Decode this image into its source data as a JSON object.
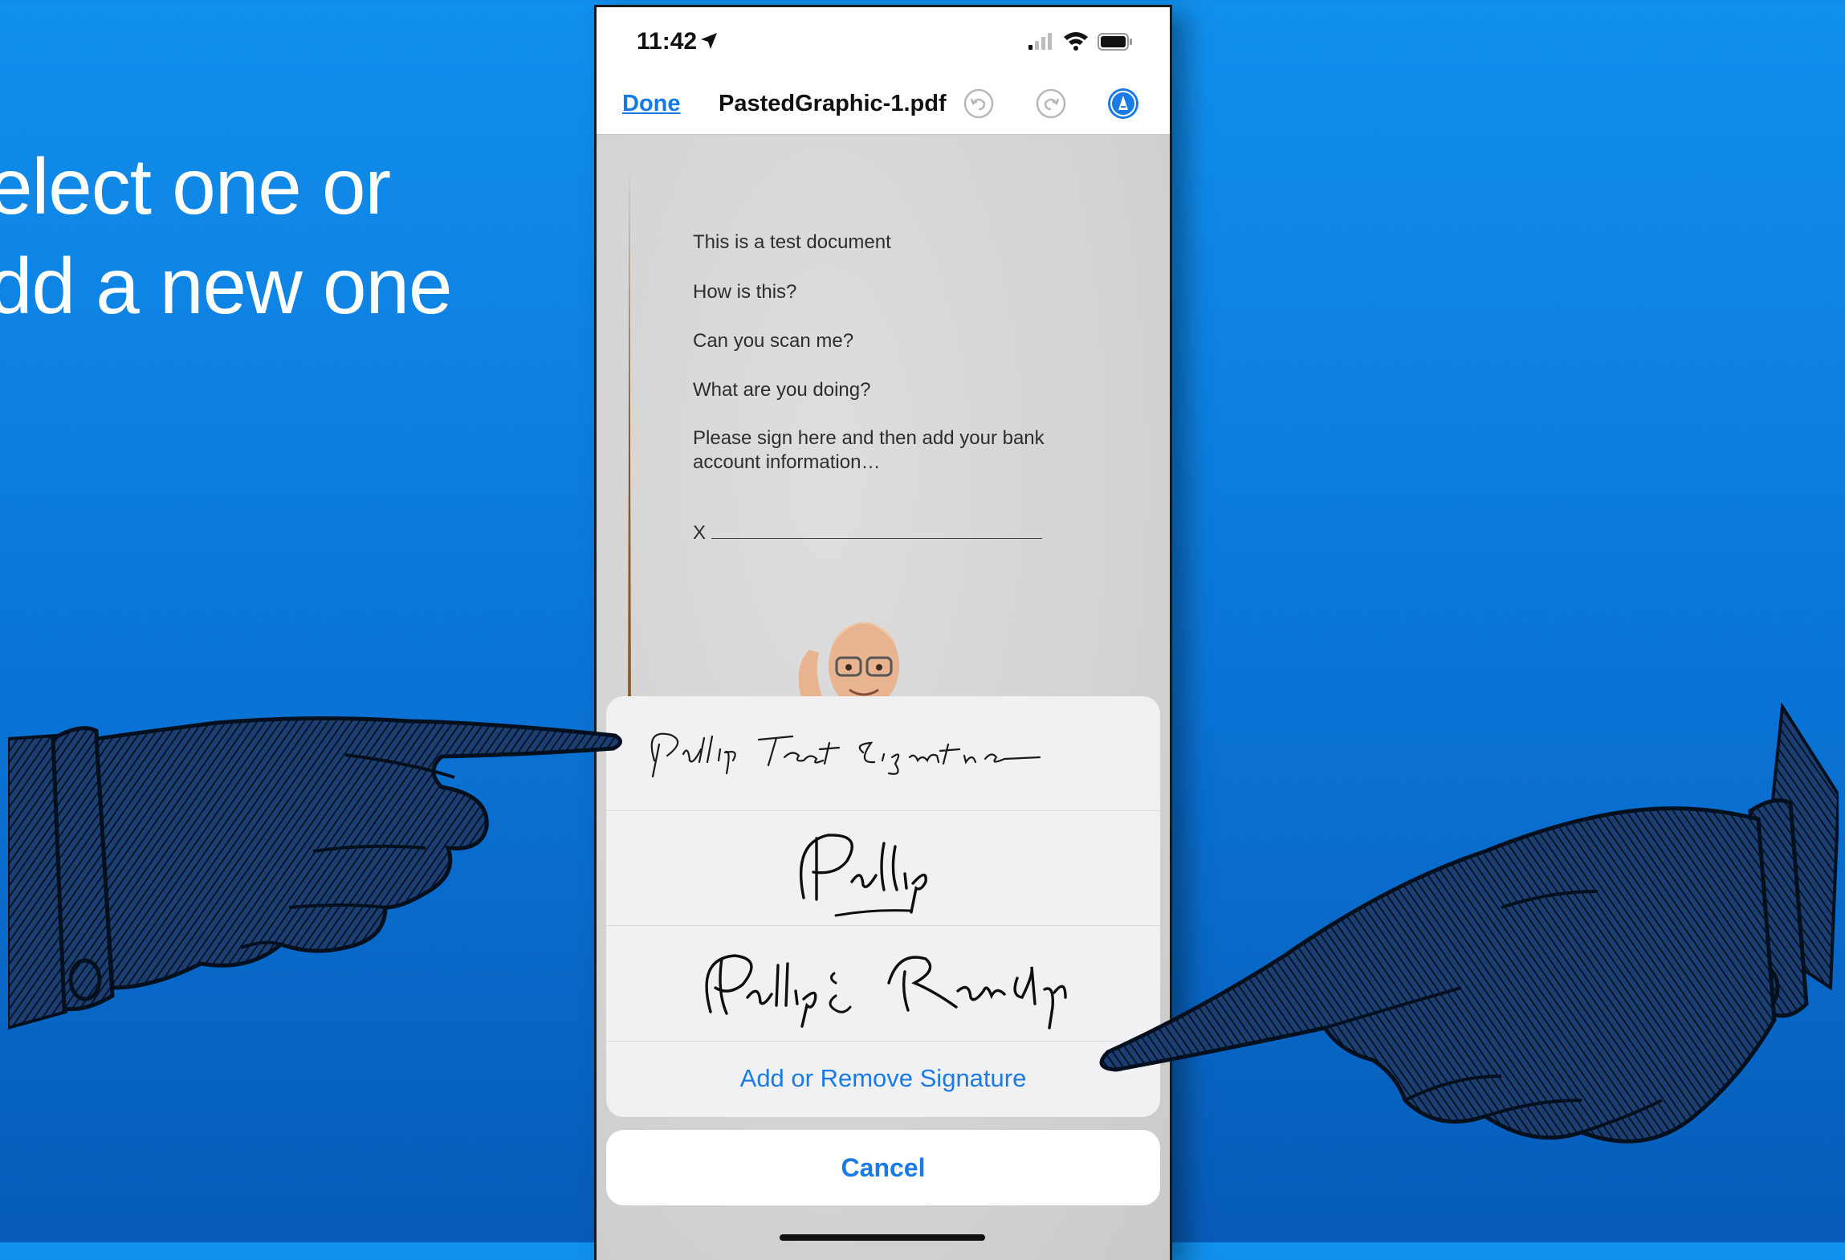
{
  "slide": {
    "headline_line1": "elect one or",
    "headline_line2": "dd a new one"
  },
  "status_bar": {
    "time": "11:42",
    "icons": [
      "location-arrow-icon",
      "cellular-signal-icon",
      "wifi-icon",
      "battery-icon"
    ]
  },
  "nav": {
    "done_label": "Done",
    "file_name": "PastedGraphic-1.pdf",
    "icons": [
      "undo-icon",
      "redo-icon",
      "markup-pen-icon"
    ]
  },
  "document": {
    "lines": [
      "This is a test document",
      "How is this?",
      "Can you scan me?",
      "What are you doing?",
      "Please sign here and then add your bank",
      "account information…"
    ],
    "signature_line": "X"
  },
  "signatures": {
    "items": [
      "Phillip Test Signature",
      "Phillip",
      "Phillip & Randy"
    ],
    "add_remove_label": "Add or Remove Signature",
    "cancel_label": "Cancel"
  },
  "colors": {
    "background_top": "#1190ee",
    "background_bottom": "#075cb8",
    "ios_blue": "#1a7ae6"
  }
}
